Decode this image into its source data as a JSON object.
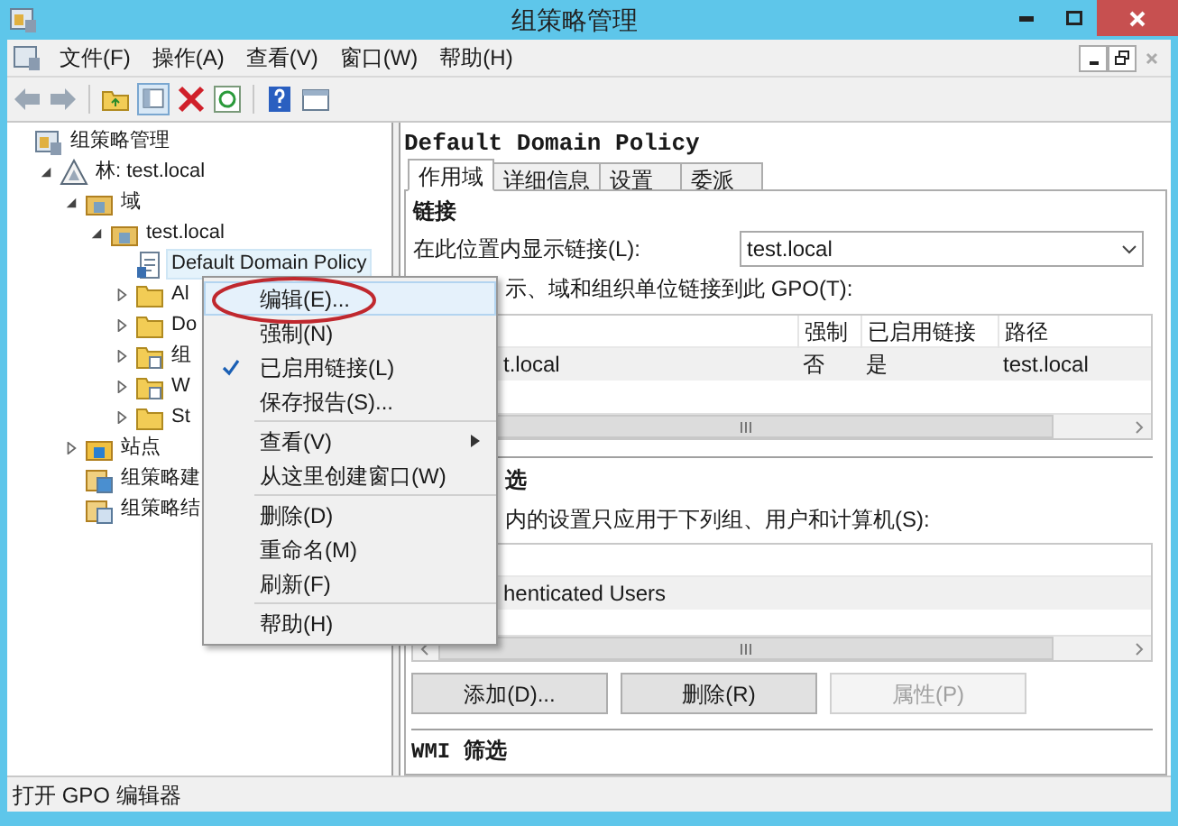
{
  "window": {
    "title": "组策略管理"
  },
  "menu_bar": [
    "文件(F)",
    "操作(A)",
    "查看(V)",
    "窗口(W)",
    "帮助(H)"
  ],
  "tree": [
    {
      "label": "组策略管理",
      "kind": "console",
      "selected": false,
      "children": [
        {
          "label": "林: test.local",
          "kind": "forest",
          "expanded": true,
          "selected": false,
          "children": [
            {
              "label": "域",
              "kind": "domains",
              "expanded": true,
              "selected": false,
              "children": [
                {
                  "label": "test.local",
                  "kind": "domain",
                  "expanded": true,
                  "selected": false,
                  "children": [
                    {
                      "label": "Default Domain Policy",
                      "kind": "gpo",
                      "selected": true
                    },
                    {
                      "label": "Al",
                      "kind": "ou",
                      "expanded": false,
                      "selected": false
                    },
                    {
                      "label": "Do",
                      "kind": "ou",
                      "expanded": false,
                      "selected": false
                    },
                    {
                      "label": "组",
                      "kind": "gpo-folder",
                      "expanded": false,
                      "selected": false
                    },
                    {
                      "label": "W",
                      "kind": "gpo-folder",
                      "expanded": false,
                      "selected": false
                    },
                    {
                      "label": "St",
                      "kind": "ou",
                      "expanded": false,
                      "selected": false
                    }
                  ]
                }
              ]
            },
            {
              "label": "站点",
              "kind": "sites",
              "expanded": false,
              "selected": false
            },
            {
              "label": "组策略建",
              "kind": "modeling",
              "selected": false
            },
            {
              "label": "组策略结",
              "kind": "results",
              "selected": false
            }
          ]
        }
      ]
    }
  ],
  "context_menu": {
    "groups": [
      [
        {
          "label": "编辑(E)...",
          "selected": true,
          "checked": false,
          "submenu": false,
          "circled": true
        },
        {
          "label": "强制(N)",
          "selected": false,
          "checked": false,
          "submenu": false,
          "circled": false
        },
        {
          "label": "已启用链接(L)",
          "selected": false,
          "checked": true,
          "submenu": false,
          "circled": false
        },
        {
          "label": "保存报告(S)...",
          "selected": false,
          "checked": false,
          "submenu": false,
          "circled": false
        }
      ],
      [
        {
          "label": "查看(V)",
          "selected": false,
          "checked": false,
          "submenu": true,
          "circled": false
        },
        {
          "label": "从这里创建窗口(W)",
          "selected": false,
          "checked": false,
          "submenu": false,
          "circled": false
        }
      ],
      [
        {
          "label": "删除(D)",
          "selected": false,
          "checked": false,
          "submenu": false,
          "circled": false
        },
        {
          "label": "重命名(M)",
          "selected": false,
          "checked": false,
          "submenu": false,
          "circled": false
        },
        {
          "label": "刷新(F)",
          "selected": false,
          "checked": false,
          "submenu": false,
          "circled": false
        }
      ],
      [
        {
          "label": "帮助(H)",
          "selected": false,
          "checked": false,
          "submenu": false,
          "circled": false
        }
      ]
    ]
  },
  "detail": {
    "title": "Default Domain Policy",
    "tabs": [
      {
        "label": "作用域",
        "selected": true
      },
      {
        "label": "详细信息",
        "selected": false
      },
      {
        "label": "设置",
        "selected": false
      },
      {
        "label": "委派",
        "selected": false
      }
    ],
    "links": {
      "heading": "链接",
      "location_label": "在此位置内显示链接(L):",
      "location_value": "test.local",
      "note": "示、域和组织单位链接到此 GPO(T):",
      "columns": [
        "强制",
        "已启用链接",
        "路径"
      ],
      "rows": [
        {
          "location": "t.local",
          "cells": [
            "否",
            "是",
            "test.local"
          ],
          "selected": true
        }
      ]
    },
    "filter": {
      "heading": "选",
      "note": "内的设置只应用于下列组、用户和计算机(S):",
      "rows": [
        {
          "name": "henticated Users",
          "selected": true
        }
      ],
      "buttons": [
        {
          "label": "添加(D)...",
          "disabled": false
        },
        {
          "label": "删除(R)",
          "disabled": false
        },
        {
          "label": "属性(P)",
          "disabled": true
        }
      ]
    },
    "wmi_heading": "WMI 筛选"
  },
  "status_bar": "打开 GPO 编辑器"
}
